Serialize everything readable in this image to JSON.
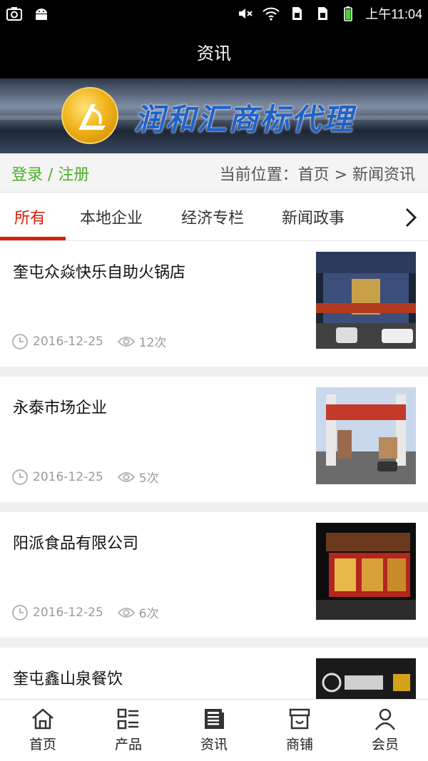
{
  "status_bar": {
    "time": "上午11:04",
    "left_icons": [
      "screenshot-icon",
      "android-icon"
    ],
    "right_icons": [
      "mute-icon",
      "wifi-icon",
      "sim1-icon",
      "sim2-icon",
      "battery-icon"
    ]
  },
  "header": {
    "title": "资讯"
  },
  "banner": {
    "text": "润和汇商标代理"
  },
  "location_bar": {
    "login_label": "登录 / 注册",
    "breadcrumb": "当前位置：首页 > 新闻资讯"
  },
  "tabs": [
    {
      "label": "所有",
      "active": true
    },
    {
      "label": "本地企业"
    },
    {
      "label": "经济专栏"
    },
    {
      "label": "新闻政事"
    }
  ],
  "news": [
    {
      "title": "奎屯众焱快乐自助火锅店",
      "date": "2016-12-25",
      "views": "12次"
    },
    {
      "title": "永泰市场企业",
      "date": "2016-12-25",
      "views": "5次"
    },
    {
      "title": "阳派食品有限公司",
      "date": "2016-12-25",
      "views": "6次"
    },
    {
      "title": "奎屯鑫山泉餐饮",
      "date": "",
      "views": ""
    }
  ],
  "bottom_nav": [
    {
      "label": "首页",
      "icon": "home-icon"
    },
    {
      "label": "产品",
      "icon": "list-icon"
    },
    {
      "label": "资讯",
      "icon": "news-icon",
      "active": true
    },
    {
      "label": "商铺",
      "icon": "shop-icon"
    },
    {
      "label": "会员",
      "icon": "user-icon"
    }
  ],
  "colors": {
    "accent": "#d81e06",
    "login": "#4caf2a",
    "meta": "#9a9a9a"
  }
}
